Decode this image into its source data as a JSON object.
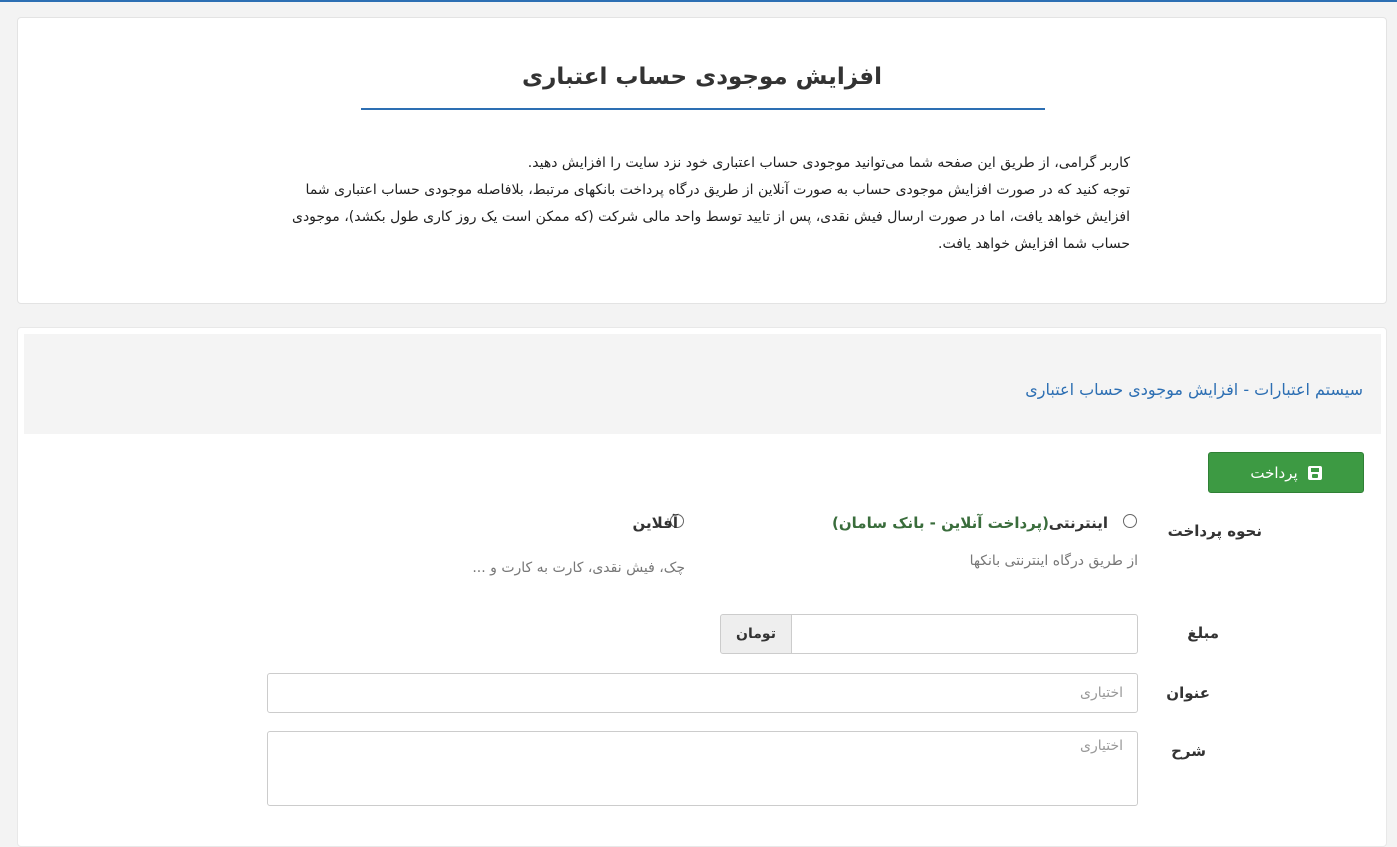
{
  "header": {
    "title": "افزایش موجودی حساب اعتباری",
    "intro_line1": "کاربر گرامی، از طریق این صفحه شما می‌توانید موجودی حساب اعتباری خود نزد سایت را افزایش دهید.",
    "intro_line2": "توجه کنید که در صورت افزایش موجودی حساب به صورت آنلاین از طریق درگاه  پرداخت بانکهای مرتبط، بلافاصله موجودی حساب اعتباری شما افزایش خواهد یافت، اما در صورت ارسال فیش نقدی، پس از تایید توسط واحد مالی شرکت (که ممکن است یک روز کاری طول بکشد)، موجودی حساب شما افزایش خواهد یافت."
  },
  "breadcrumb": {
    "text": "سیستم اعتبارات - افزایش موجودی حساب اعتباری"
  },
  "toolbar": {
    "pay_label": "پرداخت"
  },
  "form": {
    "payment_method": {
      "label": "نحوه پرداخت",
      "online": {
        "title": "اینترنتی",
        "detail": "(پرداخت آنلاین - بانک سامان)",
        "description": "از طریق درگاه اینترنتی بانکها"
      },
      "offline": {
        "title": "آفلاین",
        "description": "چک، فیش نقدی، کارت به کارت و ..."
      }
    },
    "amount": {
      "label": "مبلغ",
      "value": "",
      "unit": "تومان"
    },
    "subject": {
      "label": "عنوان",
      "placeholder": "اختیاری"
    },
    "description": {
      "label": "شرح",
      "placeholder": "اختیاری"
    }
  }
}
